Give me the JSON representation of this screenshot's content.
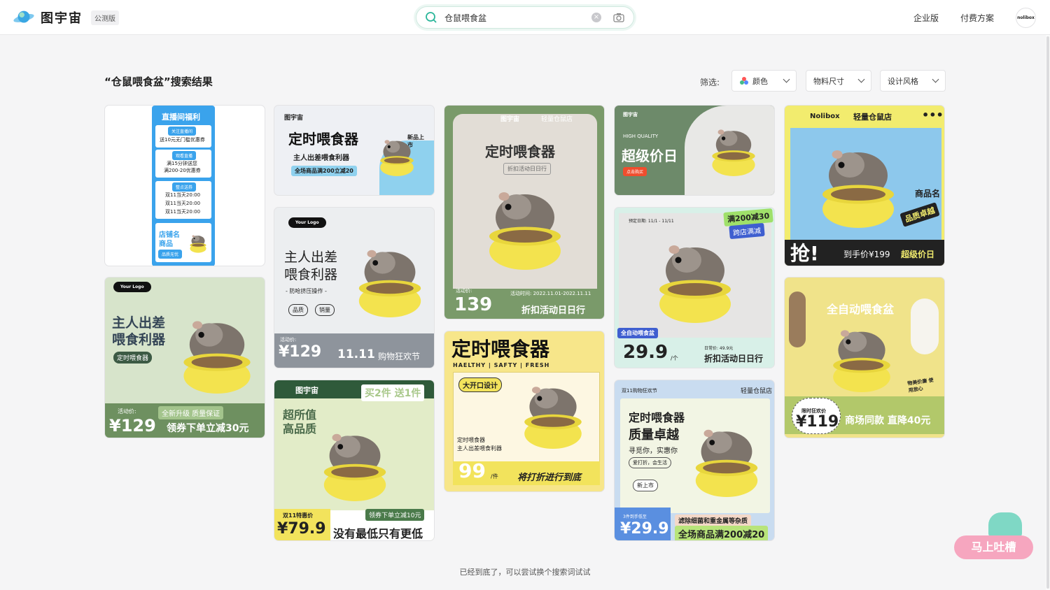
{
  "brand": {
    "name": "图宇宙",
    "badge": "公测版"
  },
  "search": {
    "value": "仓鼠喂食盆",
    "placeholder": ""
  },
  "nav": {
    "enterprise": "企业版",
    "pricing": "付费方案",
    "avatar": "nolibox"
  },
  "page": {
    "title": "“仓鼠喂食盆”搜索结果",
    "filter_label": "筛选:",
    "footer": "已经到底了，可以尝试换个搜索词试试",
    "feedback": "马上吐槽"
  },
  "filters": [
    {
      "label": "颜色"
    },
    {
      "label": "物料尺寸"
    },
    {
      "label": "设计风格"
    }
  ],
  "colors": {
    "accent": "#2bb69a",
    "yellow": "#f2e35c",
    "green": "#5a7a5c",
    "pink": "#f6a6bf"
  },
  "cards": {
    "c1": {
      "title": "直播间福利",
      "t1": "关注直播间",
      "t2": "送10元无门槛优惠券",
      "t3": "观看直播",
      "t4": "满15分钟送您",
      "t5": "满200-20优惠券",
      "t6": "整点送券",
      "t7": "双11当天20:00",
      "t8": "双11当天20:00",
      "t9": "双11当天20:00",
      "t10": "店铺名",
      "t11": "商品",
      "t12": "品质无忧"
    },
    "c2": {
      "logo": "图宇宙",
      "title": "定时喂食器",
      "sub": "主人出差喂食利器",
      "promo": "全场商品满200立减20",
      "badge": "新品上市"
    },
    "c3": {
      "logo": "图宇宙",
      "shop": "轻量仓鼠店",
      "title": "定时喂食器",
      "sub": "折扣活动日日行",
      "plabel": "活动价:",
      "price": "139",
      "date": "活动时间: 2022.11.01-2022.11.11",
      "slogan": "折扣活动日日行"
    },
    "c4": {
      "logo": "图宇宙",
      "hq": "HIGH QUALITY",
      "title": "超级价日",
      "btn": "点击购买"
    },
    "c5": {
      "logo": "Nolibox",
      "shop": "轻量仓鼠店",
      "n1": "商品名",
      "n2": "品质卓越",
      "big": "抢!",
      "price": "到手价¥199",
      "tag": "超级价日"
    },
    "c6": {
      "logo": "Your Logo",
      "t1": "主人出差",
      "t2": "喂食利器",
      "t3": "- 防呛挤压操作 -",
      "b1": "品质",
      "b2": "销量",
      "plabel": "活动价:",
      "price": "¥129",
      "slogan": "11.11",
      "slogan2": "购物狂欢节"
    },
    "c7": {
      "title": "定时喂食器",
      "sub": "HAELTHY | SAFTY | FRESH",
      "btn": "大开口设计",
      "d1": "定时喂食器",
      "d2": "主人出差喂食利器",
      "price": "99",
      "unit": "/件",
      "slogan": "将打折进行到底"
    },
    "c8": {
      "date": "预定日期: 11/1 - 11/11",
      "tag1": "满200减30",
      "tag2": "跨店满减",
      "cat": "全自动喂食盆",
      "price": "29.9",
      "unit": "/个",
      "daily": "日常价: 49.9元",
      "slogan": "折扣活动日日行"
    },
    "c9": {
      "logo": "Your Logo",
      "t1": "主人出差",
      "t2": "喂食利器",
      "btn": "定时喂食器",
      "plabel": "活动价:",
      "bar": "全新升级 质量保证",
      "price": "¥129",
      "slogan": "领券下单立减30元"
    },
    "c10": {
      "title": "全自动喂食盆",
      "badge": "物美价廉 使用放心",
      "plabel": "限时狂欢价",
      "price": "¥119",
      "slogan": "商场同款 直降40元"
    },
    "c11": {
      "logo": "图宇宙",
      "tag": "买2件 送1件",
      "t1": "超所值",
      "t2": "高品质",
      "plabel": "双11特惠价",
      "coupon": "领券下单立减10元",
      "price": "¥79.9",
      "slogan": "没有最低只有更低"
    },
    "c12": {
      "top": "双11购物狂欢节",
      "shop": "轻量仓鼠店",
      "t1": "定时喂食器",
      "t2": "质量卓越",
      "t3": "寻觅你，实惠你",
      "t4": "爱打折，会生活",
      "new": "新上市",
      "plabel": "3件到手低至",
      "price": "¥29.9",
      "bar": "滤除细菌和重金属等杂质",
      "slogan": "全场商品满200减20"
    }
  }
}
